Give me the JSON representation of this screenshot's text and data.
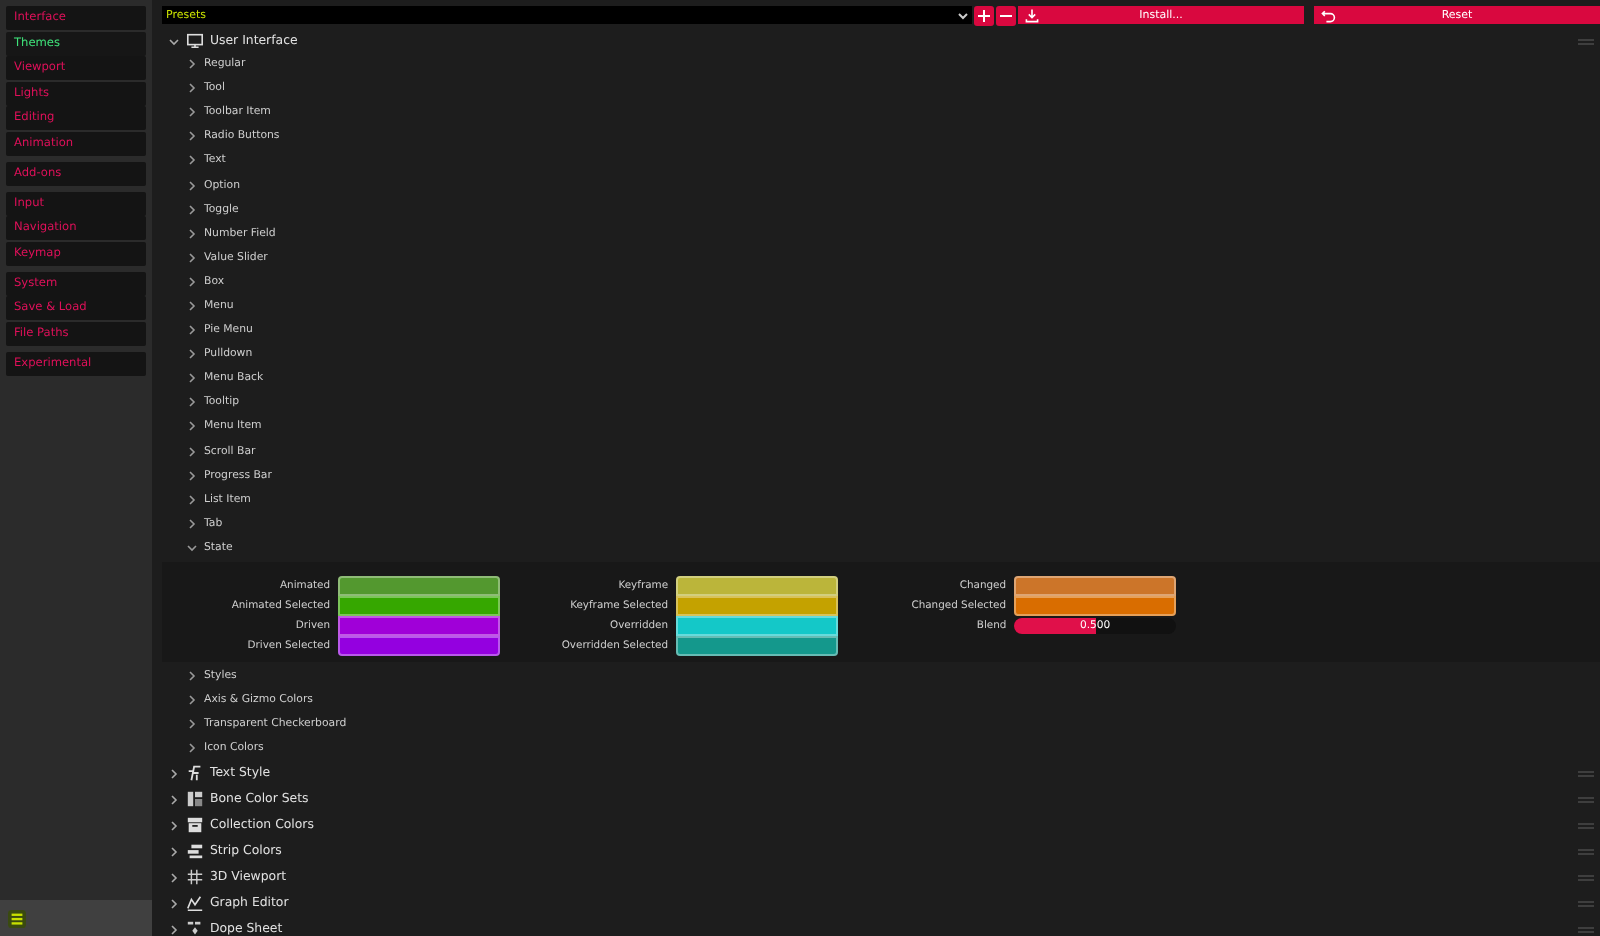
{
  "sidebar": {
    "groups": [
      [
        {
          "label": "Interface",
          "selected": false
        },
        {
          "label": "Themes",
          "selected": true
        },
        {
          "label": "Viewport",
          "selected": false
        },
        {
          "label": "Lights",
          "selected": false
        },
        {
          "label": "Editing",
          "selected": false
        },
        {
          "label": "Animation",
          "selected": false
        }
      ],
      [
        {
          "label": "Add-ons",
          "selected": false
        }
      ],
      [
        {
          "label": "Input",
          "selected": false
        },
        {
          "label": "Navigation",
          "selected": false
        },
        {
          "label": "Keymap",
          "selected": false
        }
      ],
      [
        {
          "label": "System",
          "selected": false
        },
        {
          "label": "Save & Load",
          "selected": false
        },
        {
          "label": "File Paths",
          "selected": false
        }
      ],
      [
        {
          "label": "Experimental",
          "selected": false
        }
      ]
    ]
  },
  "toolbar": {
    "presets": "Presets",
    "install": "Install...",
    "reset": "Reset"
  },
  "sections": [
    {
      "label": "User Interface",
      "expanded": true,
      "children": [
        {
          "label": "Regular",
          "expanded": false
        },
        {
          "label": "Tool",
          "expanded": false
        },
        {
          "label": "Toolbar Item",
          "expanded": false
        },
        {
          "label": "Radio Buttons",
          "expanded": false
        },
        {
          "label": "Text",
          "expanded": false
        },
        {
          "label": "Option",
          "expanded": false
        },
        {
          "label": "Toggle",
          "expanded": false
        },
        {
          "label": "Number Field",
          "expanded": false
        },
        {
          "label": "Value Slider",
          "expanded": false
        },
        {
          "label": "Box",
          "expanded": false
        },
        {
          "label": "Menu",
          "expanded": false
        },
        {
          "label": "Pie Menu",
          "expanded": false
        },
        {
          "label": "Pulldown",
          "expanded": false
        },
        {
          "label": "Menu Back",
          "expanded": false
        },
        {
          "label": "Tooltip",
          "expanded": false
        },
        {
          "label": "Menu Item",
          "expanded": false
        },
        {
          "label": "Scroll Bar",
          "expanded": false
        },
        {
          "label": "Progress Bar",
          "expanded": false
        },
        {
          "label": "List Item",
          "expanded": false
        },
        {
          "label": "Tab",
          "expanded": false
        },
        {
          "label": "State",
          "expanded": true,
          "columns": [
            [
              {
                "kind": "swatch",
                "label": "Animated",
                "color": "#53982f"
              },
              {
                "kind": "swatch",
                "label": "Animated Selected",
                "color": "#36a700"
              },
              {
                "kind": "swatch",
                "label": "Driven",
                "color": "#a000d8"
              },
              {
                "kind": "swatch",
                "label": "Driven Selected",
                "color": "#9400e0"
              }
            ],
            [
              {
                "kind": "swatch",
                "label": "Keyframe",
                "color": "#bbb53a"
              },
              {
                "kind": "swatch",
                "label": "Keyframe Selected",
                "color": "#c4a200"
              },
              {
                "kind": "swatch",
                "label": "Overridden",
                "color": "#14c8c8"
              },
              {
                "kind": "swatch",
                "label": "Overridden Selected",
                "color": "#14988c"
              }
            ],
            [
              {
                "kind": "swatch",
                "label": "Changed",
                "color": "#cc7529"
              },
              {
                "kind": "swatch",
                "label": "Changed Selected",
                "color": "#d96d00"
              },
              {
                "kind": "slider",
                "label": "Blend",
                "level": 0.5,
                "reading": "0.500"
              }
            ]
          ]
        },
        {
          "label": "Styles",
          "expanded": false
        },
        {
          "label": "Axis & Gizmo Colors",
          "expanded": false
        },
        {
          "label": "Transparent Checkerboard",
          "expanded": false
        },
        {
          "label": "Icon Colors",
          "expanded": false
        }
      ]
    },
    {
      "label": "Text Style",
      "expanded": false
    },
    {
      "label": "Bone Color Sets",
      "expanded": false
    },
    {
      "label": "Collection Colors",
      "expanded": false
    },
    {
      "label": "Strip Colors",
      "expanded": false
    },
    {
      "label": "3D Viewport",
      "expanded": false
    },
    {
      "label": "Graph Editor",
      "expanded": false
    },
    {
      "label": "Dope Sheet",
      "expanded": false
    }
  ]
}
